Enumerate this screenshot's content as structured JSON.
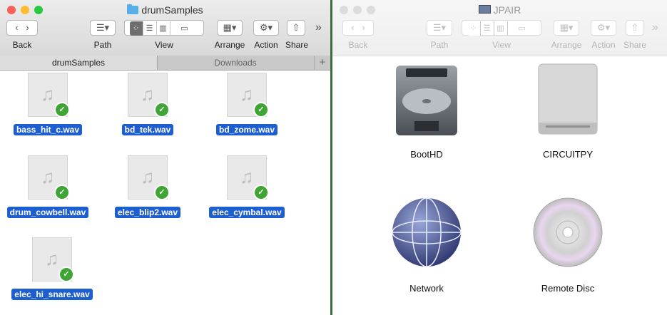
{
  "left_window": {
    "title": "drumSamples",
    "toolbar": {
      "back_label": "Back",
      "path_label": "Path",
      "view_label": "View",
      "arrange_label": "Arrange",
      "action_label": "Action",
      "share_label": "Share",
      "overflow": "»"
    },
    "tabs": [
      {
        "label": "drumSamples",
        "active": true
      },
      {
        "label": "Downloads",
        "active": false
      }
    ],
    "new_tab": "+",
    "files": [
      {
        "name": "bass_hit_c.wav"
      },
      {
        "name": "bd_tek.wav"
      },
      {
        "name": "bd_zome.wav"
      },
      {
        "name": "drum_cowbell.wav"
      },
      {
        "name": "elec_blip2.wav"
      },
      {
        "name": "elec_cymbal.wav"
      },
      {
        "name": "elec_hi_snare.wav"
      }
    ]
  },
  "right_window": {
    "title": "JPAIR",
    "toolbar": {
      "back_label": "Back",
      "path_label": "Path",
      "view_label": "View",
      "arrange_label": "Arrange",
      "action_label": "Action",
      "share_label": "Share",
      "overflow": "»"
    },
    "devices": [
      {
        "name": "BootHD",
        "icon": "hard-drive-icon"
      },
      {
        "name": "CIRCUITPY",
        "icon": "external-drive-icon"
      },
      {
        "name": "Network",
        "icon": "network-globe-icon"
      },
      {
        "name": "Remote Disc",
        "icon": "optical-disc-icon"
      }
    ]
  },
  "colors": {
    "selection": "#1d5fd0",
    "sync_check": "#3fa535",
    "folder": "#5aaee8"
  }
}
